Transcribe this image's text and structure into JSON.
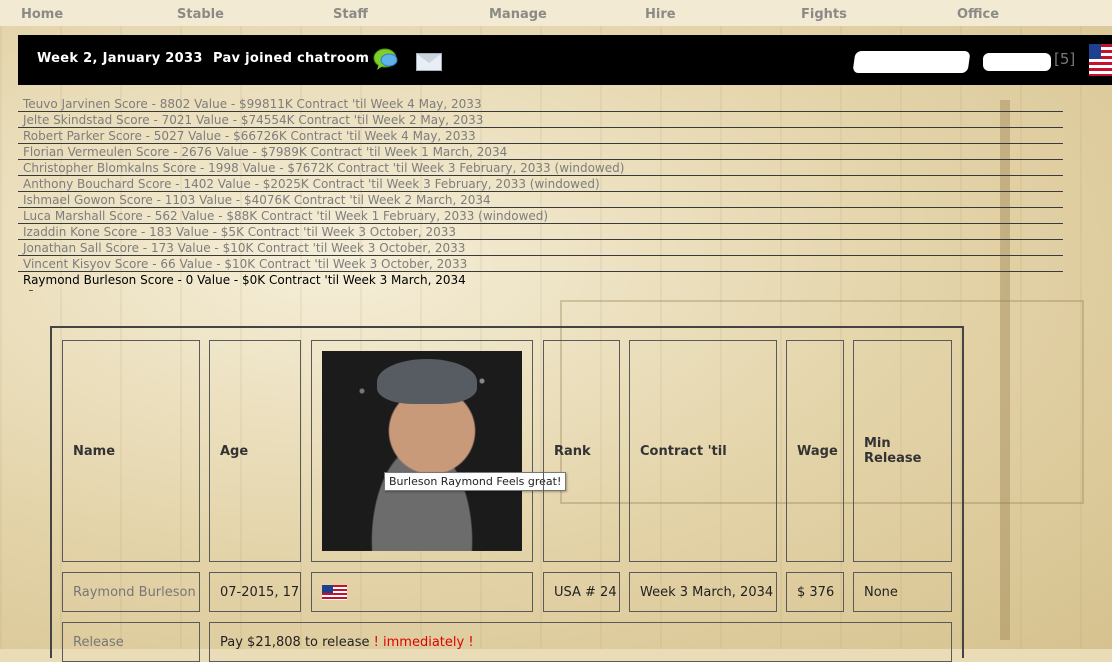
{
  "nav": {
    "items": [
      "Home",
      "Stable",
      "Staff",
      "Manage",
      "Hire",
      "Fights",
      "Office"
    ]
  },
  "banner": {
    "week": "Week 2, January 2033",
    "chat_status": "Pav joined chatroom",
    "count": "[5]"
  },
  "roster": [
    "Teuvo Jarvinen Score - 8802 Value - $99811K Contract 'til Week 4 May, 2033",
    "Jelte Skindstad Score - 7021 Value - $74554K Contract 'til Week 2 May, 2033",
    "Robert Parker Score - 5027 Value - $66726K Contract 'til Week 4 May, 2033",
    "Florian Vermeulen Score - 2676 Value - $7989K Contract 'til Week 1 March, 2034",
    "Christopher Blomkalns Score - 1998 Value - $7672K Contract 'til Week 3 February, 2033 (windowed)",
    "Anthony Bouchard Score - 1402 Value - $2025K Contract 'til Week 3 February, 2033 (windowed)",
    "Ishmael Gowon Score - 1103 Value - $4076K Contract 'til Week 2 March, 2034",
    "Luca Marshall Score - 562 Value - $88K Contract 'til Week 1 February, 2033 (windowed)",
    "Izaddin Kone Score - 183 Value - $5K Contract 'til Week 3 October, 2033",
    "Jonathan Sall Score - 173 Value - $10K Contract 'til Week 3 October, 2033",
    "Vincent Kisyov Score - 66 Value - $10K Contract 'til Week 3 October, 2033",
    "Raymond Burleson Score - 0 Value - $0K Contract 'til Week 3 March, 2034"
  ],
  "headers": {
    "name": "Name",
    "age": "Age",
    "rank": "Rank",
    "contract": "Contract 'til",
    "wage": "Wage",
    "min_release": "Min Release"
  },
  "tooltip": "Burleson Raymond Feels great!",
  "fighter": {
    "name": "Raymond Burleson",
    "age": "07-2015, 17",
    "rank": "USA # 24",
    "contract": "Week 3 March, 2034",
    "wage": "$ 376",
    "min_release": "None"
  },
  "release": {
    "label": "Release",
    "text": "Pay $21,808 to release",
    "emphasis": "! immediately !"
  }
}
